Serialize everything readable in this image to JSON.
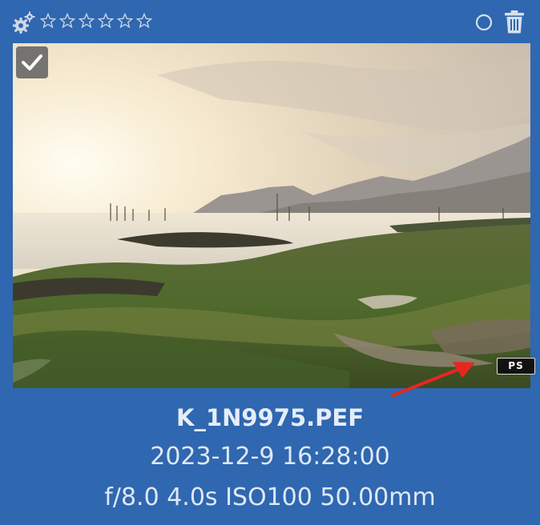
{
  "toolbar": {
    "settings_icon": "gear-icon",
    "rating": {
      "value": 0,
      "max": 6
    },
    "select_icon": "circle-icon",
    "delete_icon": "trash-icon"
  },
  "photo": {
    "selected": true,
    "badge": "PS"
  },
  "info": {
    "filename": "K_1N9975.PEF",
    "datetime": "2023-12-9 16:28:00",
    "exif": "f/8.0 4.0s ISO100 50.00mm"
  },
  "colors": {
    "background": "#2f67b0",
    "annotation_arrow": "#e8261f"
  }
}
